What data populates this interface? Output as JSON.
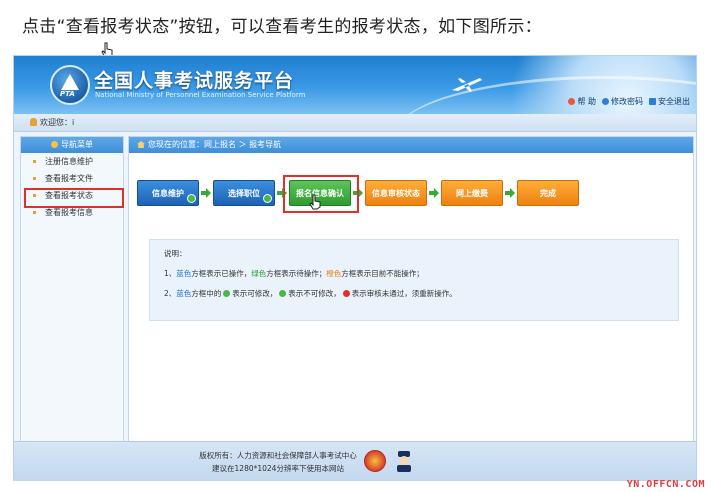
{
  "instruction": "点击“查看报考状态”按钮，可以查看考生的报考状态，如下图所示：",
  "header": {
    "title": "全国人事考试服务平台",
    "subtitle": "National Ministry of Personnel Examination Service Platform",
    "logo_text": "PTA",
    "links": [
      "帮 助",
      "修改密码",
      "安全退出"
    ]
  },
  "welcome": {
    "label": "欢迎您：",
    "user": "i"
  },
  "sidebar": {
    "title": "导航菜单",
    "items": [
      "注册信息维护",
      "查看报考文件",
      "查看报考状态",
      "查看报考信息"
    ],
    "highlighted_index": 2
  },
  "breadcrumb": "您现在的位置：网上报名 ＞ 报考导航",
  "steps": [
    {
      "label": "信息维护",
      "state": "blue",
      "done": true
    },
    {
      "label": "选择职位",
      "state": "blue",
      "done": true
    },
    {
      "label": "报名信息确认",
      "state": "green",
      "done": false
    },
    {
      "label": "信息审核状态",
      "state": "orange",
      "done": false
    },
    {
      "label": "网上缴费",
      "state": "orange",
      "done": false
    },
    {
      "label": "完成",
      "state": "orange",
      "done": false
    }
  ],
  "note": {
    "title": "说明：",
    "line1": {
      "num": "1、",
      "blue": "蓝色",
      "t1": "方框表示已操作，",
      "green": "绿色",
      "t2": "方框表示待操作；",
      "orange": "橙色",
      "t3": "方框表示目前不能操作；"
    },
    "line2": {
      "num": "2、",
      "blue": "蓝色",
      "t1": "方框中的",
      "t2": "表示可修改，",
      "t3": "表示不可修改，",
      "t4": "表示审核未通过，须重新操作。"
    }
  },
  "footer": {
    "line1": "版权所有：人力资源和社会保障部人事考试中心",
    "line2": "建议在1280*1024分辨率下使用本网站"
  },
  "watermark": "YN.OFFCN.COM",
  "colors": {
    "blue_step": "#1f62b5",
    "green_step": "#2f9b2f",
    "orange_step": "#f0800e",
    "highlight_red": "#e0302c"
  }
}
